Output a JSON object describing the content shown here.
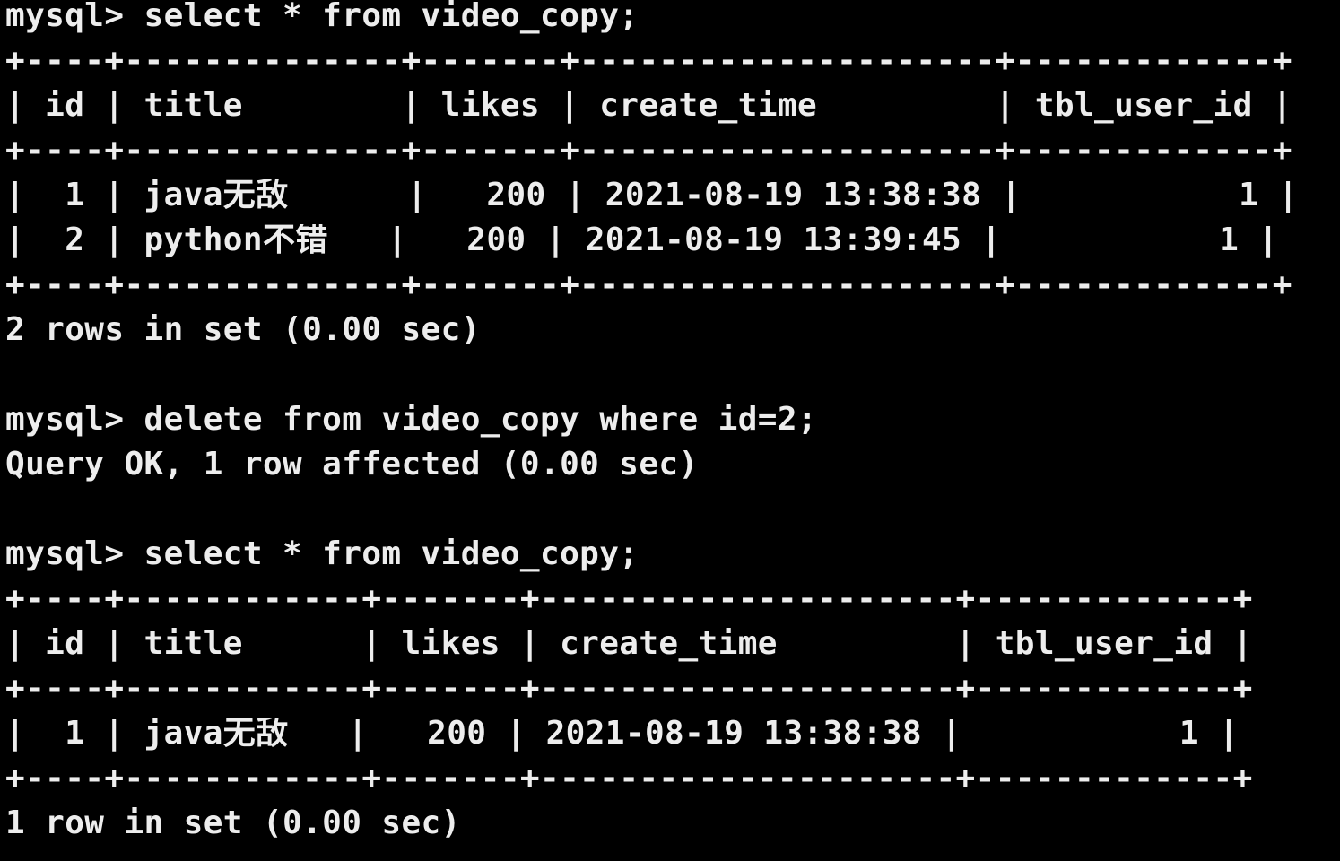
{
  "terminal": {
    "background_color": "#000000",
    "text_color": "#ededed",
    "lines": [
      "mysql> select * from video_copy;",
      "+----+--------------+-------+---------------------+-------------+",
      "| id | title        | likes | create_time         | tbl_user_id |",
      "+----+--------------+-------+---------------------+-------------+",
      "|  1 | java无敌      |   200 | 2021-08-19 13:38:38 |           1 |",
      "|  2 | python不错   |   200 | 2021-08-19 13:39:45 |           1 |",
      "+----+--------------+-------+---------------------+-------------+",
      "2 rows in set (0.00 sec)",
      "",
      "mysql> delete from video_copy where id=2;",
      "Query OK, 1 row affected (0.00 sec)",
      "",
      "mysql> select * from video_copy;",
      "+----+------------+-------+---------------------+-------------+",
      "| id | title      | likes | create_time         | tbl_user_id |",
      "+----+------------+-------+---------------------+-------------+",
      "|  1 | java无敌   |   200 | 2021-08-19 13:38:38 |           1 |",
      "+----+------------+-------+---------------------+-------------+",
      "1 row in set (0.00 sec)"
    ]
  }
}
